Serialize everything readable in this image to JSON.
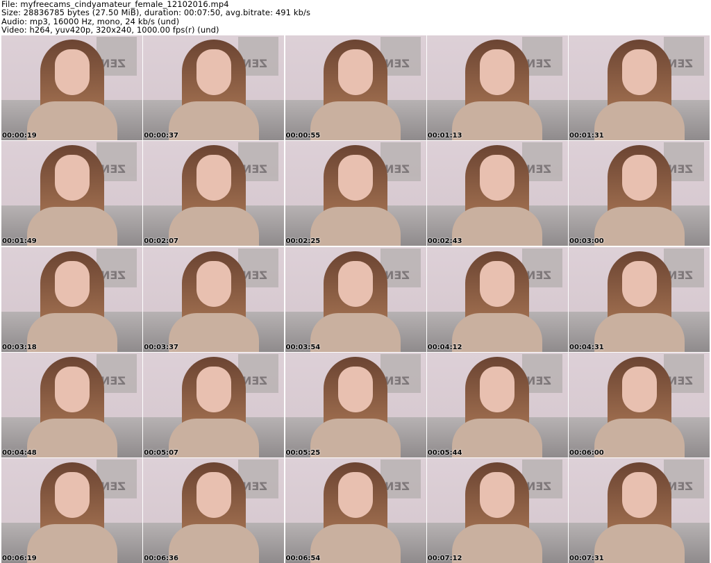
{
  "header": {
    "line1": "File: myfreecams_cindyamateur_female_12102016.mp4",
    "line2": "Size: 28836785 bytes (27.50 MiB), duration: 00:07:50, avg.bitrate: 491 kb/s",
    "line3": "Audio: mp3, 16000 Hz, mono, 24 kb/s (und)",
    "line4": "Video: h264, yuv420p, 320x240, 1000.00 fps(r) (und)"
  },
  "thumbnails": [
    {
      "time": "00:00:19"
    },
    {
      "time": "00:00:37"
    },
    {
      "time": "00:00:55"
    },
    {
      "time": "00:01:13"
    },
    {
      "time": "00:01:31"
    },
    {
      "time": "00:01:49"
    },
    {
      "time": "00:02:07"
    },
    {
      "time": "00:02:25"
    },
    {
      "time": "00:02:43"
    },
    {
      "time": "00:03:00"
    },
    {
      "time": "00:03:18"
    },
    {
      "time": "00:03:37"
    },
    {
      "time": "00:03:54"
    },
    {
      "time": "00:04:12"
    },
    {
      "time": "00:04:31"
    },
    {
      "time": "00:04:48"
    },
    {
      "time": "00:05:07"
    },
    {
      "time": "00:05:25"
    },
    {
      "time": "00:05:44"
    },
    {
      "time": "00:06:00"
    },
    {
      "time": "00:06:19"
    },
    {
      "time": "00:06:36"
    },
    {
      "time": "00:06:54"
    },
    {
      "time": "00:07:12"
    },
    {
      "time": "00:07:31"
    }
  ]
}
